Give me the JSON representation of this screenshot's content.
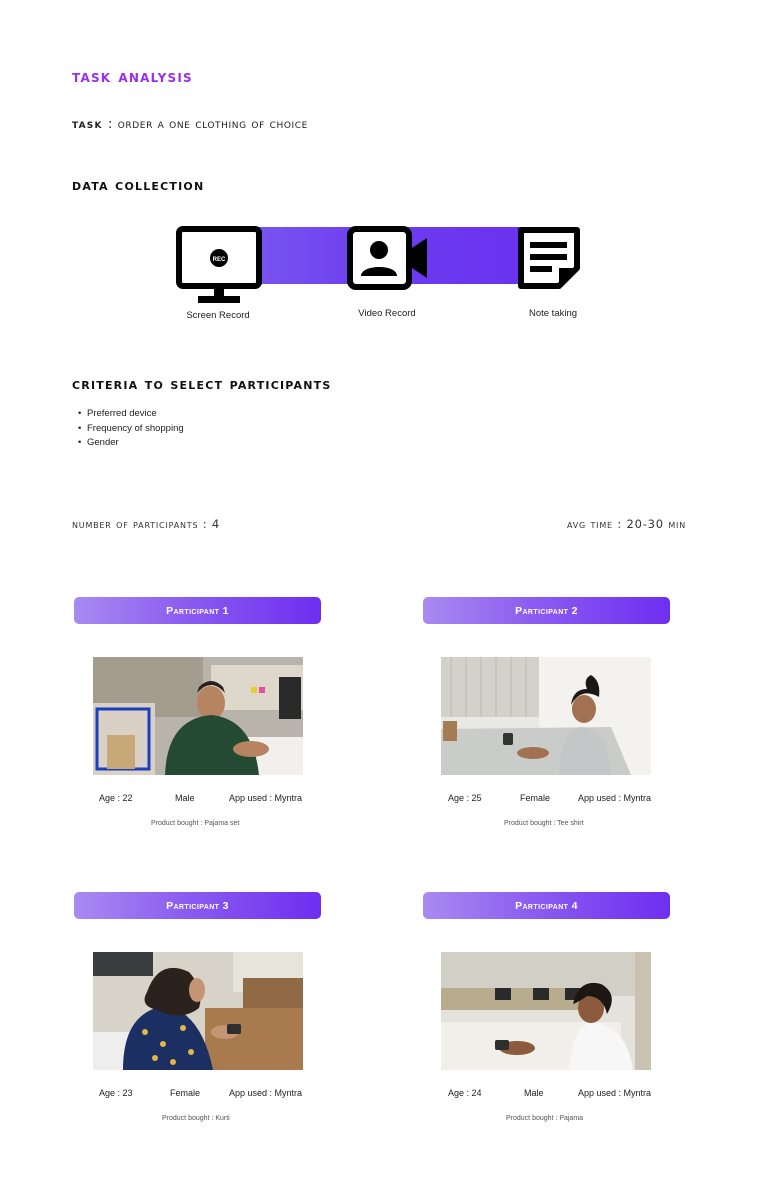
{
  "title": "task analysis",
  "task": {
    "label": "task",
    "value": ": order a one clothing of choice"
  },
  "data_collection": {
    "heading": "data collection",
    "methods": [
      {
        "label": "Screen Record",
        "icon": "monitor-rec-icon",
        "badge": "REC"
      },
      {
        "label": "Video Record",
        "icon": "video-camera-icon"
      },
      {
        "label": "Note taking",
        "icon": "sticky-note-icon"
      }
    ],
    "accent": "#6a2ef0"
  },
  "criteria": {
    "heading": "criteria to select participants",
    "items": [
      "Preferred device",
      "Frequency of shopping",
      "Gender"
    ]
  },
  "num_participants": "Number of participants : 4",
  "avg_time": "avg time : 20-30 min",
  "participants": [
    {
      "title": "Participant 1",
      "age": "Age : 22",
      "gender": "Male",
      "app": "App used : Myntra",
      "bought": "Product bought : Pajama set"
    },
    {
      "title": "Participant 2",
      "age": "Age : 25",
      "gender": "Female",
      "app": "App used : Myntra",
      "bought": "Product bought : Tee shirt"
    },
    {
      "title": "Participant 3",
      "age": "Age : 23",
      "gender": "Female",
      "app": "App used : Myntra",
      "bought": "Product bought : Kurti"
    },
    {
      "title": "Participant 4",
      "age": "Age : 24",
      "gender": "Male",
      "app": "App used : Myntra",
      "bought": "Product bought : Pajama"
    }
  ],
  "colors": {
    "title": "#9a2ff0",
    "banner_start": "#a88bf1",
    "banner_end": "#6e2ef0"
  }
}
